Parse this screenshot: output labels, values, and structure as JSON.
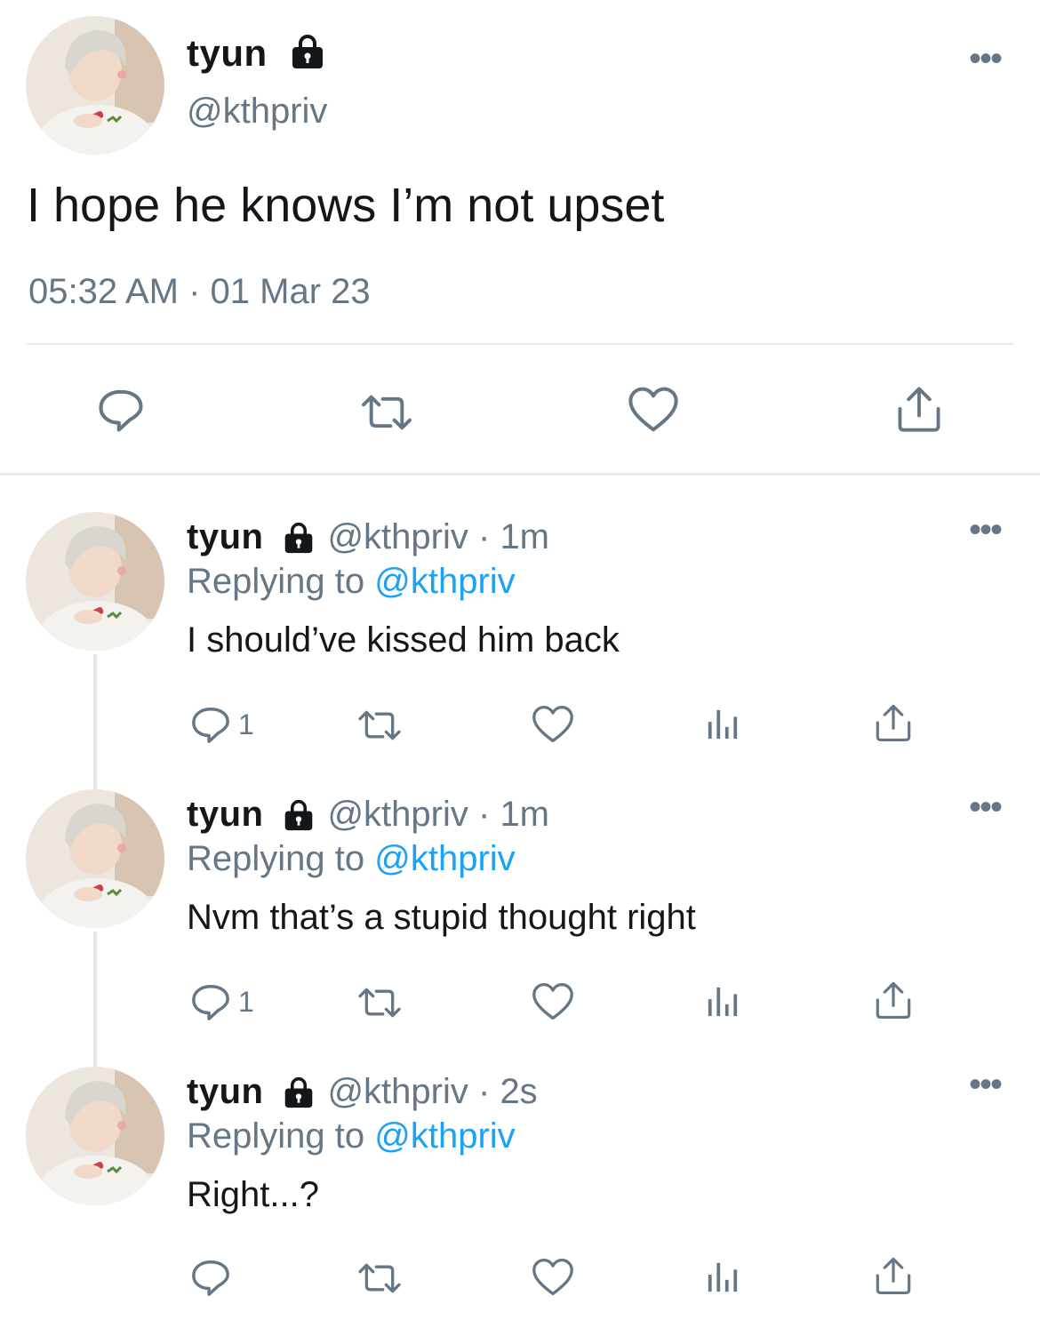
{
  "main_tweet": {
    "author_name": "tyun",
    "author_handle": "@kthpriv",
    "text": "I hope he knows I’m not upset",
    "timestamp": "05:32 AM · 01 Mar 23",
    "more_label": "•••",
    "icons": [
      "lock-icon",
      "reply-icon",
      "retweet-icon",
      "like-icon",
      "share-icon"
    ]
  },
  "replies": [
    {
      "author_name": "tyun",
      "handle": "@kthpriv",
      "separator": "·",
      "time": "1m",
      "replying_prefix": "Replying to ",
      "replying_to": "@kthpriv",
      "text": "I should’ve kissed him back",
      "reply_count": "1",
      "more_label": "•••"
    },
    {
      "author_name": "tyun",
      "handle": "@kthpriv",
      "separator": "·",
      "time": "1m",
      "replying_prefix": "Replying to ",
      "replying_to": "@kthpriv",
      "text": "Nvm that’s a stupid thought right",
      "reply_count": "1",
      "more_label": "•••"
    },
    {
      "author_name": "tyun",
      "handle": "@kthpriv",
      "separator": "·",
      "time": "2s",
      "replying_prefix": "Replying to ",
      "replying_to": "@kthpriv",
      "text": "Right...?",
      "reply_count": "",
      "more_label": "•••"
    }
  ],
  "colors": {
    "text": "#14171a",
    "secondary": "#657786",
    "link": "#1da1f2",
    "divider": "#e6ecf0"
  }
}
